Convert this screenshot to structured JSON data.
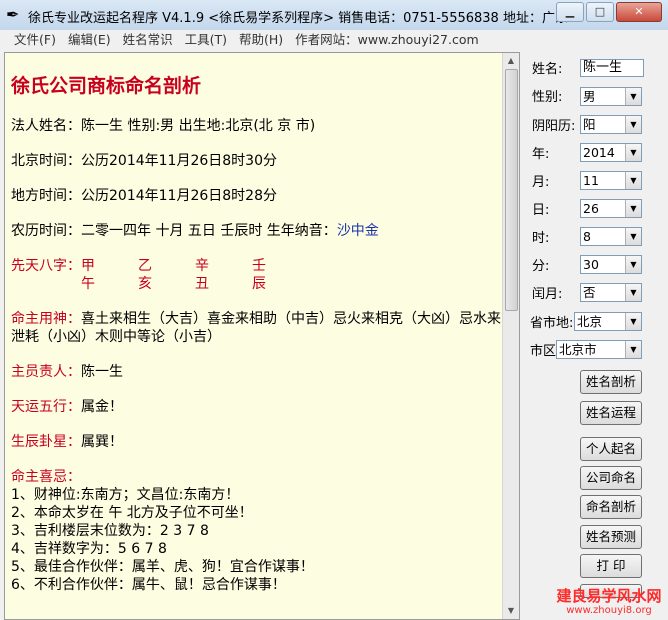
{
  "window": {
    "title": "徐氏专业改运起名程序 V4.1.9 <徐氏易学系列程序>   销售电话：0751-5556838    地址：广东..."
  },
  "menu": [
    "文件(F)",
    "编辑(E)",
    "姓名常识",
    "工具(T)",
    "帮助(H)",
    "作者网站：www.zhouyi27.com"
  ],
  "report": {
    "title": "徐氏公司商标命名剖析",
    "legal_person": "法人姓名：陈一生  性别:男   出生地:北京(北 京 市)",
    "beijing_time": "北京时间：公历2014年11月26日8时30分",
    "local_time": "地方时间：公历2014年11月26日8时28分",
    "lunar_time": "农历时间：二零一四年 十月 五日 壬辰时    生年纳音：",
    "nayin": "沙中金",
    "bazi_label": "先天八字：",
    "bazi_stems": [
      "甲",
      "乙",
      "辛",
      "壬"
    ],
    "bazi_branches": [
      "午",
      "亥",
      "丑",
      "辰"
    ],
    "yongshen_label": "命主用神：",
    "yongshen_text": "喜土来相生（大吉）喜金来相助（中吉）忌火来相克（大凶）忌水来泄耗（小凶）木则中等论（小吉）",
    "owner_label": "主员责人：",
    "owner_value": "陈一生",
    "wuxing_label": "天运五行：",
    "wuxing_value": "属金！",
    "gua_label": "生辰卦星：",
    "gua_value": "属巽！",
    "likes_label": "命主喜忌：",
    "likes": [
      "1、财神位:东南方；文昌位:东南方！",
      "2、本命太岁在 午 北方及子位不可坐！",
      "3、吉利楼层末位数为：2 3 7 8",
      "4、吉祥数字为：5 6 7 8",
      "5、最佳合作伙伴：属羊、虎、狗！宜合作谋事！",
      "6、不利合作伙伴：属牛、鼠！忌合作谋事！"
    ]
  },
  "form": {
    "name_label": "姓名:",
    "name_value": "陈一生",
    "gender_label": "性别:",
    "gender_value": "男",
    "calendar_label": "阴阳历:",
    "calendar_value": "阳",
    "year_label": "年:",
    "year_value": "2014",
    "month_label": "月:",
    "month_value": "11",
    "day_label": "日:",
    "day_value": "26",
    "hour_label": "时:",
    "hour_value": "8",
    "minute_label": "分:",
    "minute_value": "30",
    "leap_label": "闰月:",
    "leap_value": "否",
    "province_label": "省市地:",
    "province_value": "北京",
    "city_label": "市区",
    "city_value": "北京市"
  },
  "buttons": [
    "姓名剖析",
    "姓名运程",
    "个人起名",
    "公司命名",
    "命名剖析",
    "姓名预测",
    "打 印"
  ],
  "watermark": {
    "line1": "建良易学风水网",
    "line2": "www.zhouyi8.org"
  }
}
